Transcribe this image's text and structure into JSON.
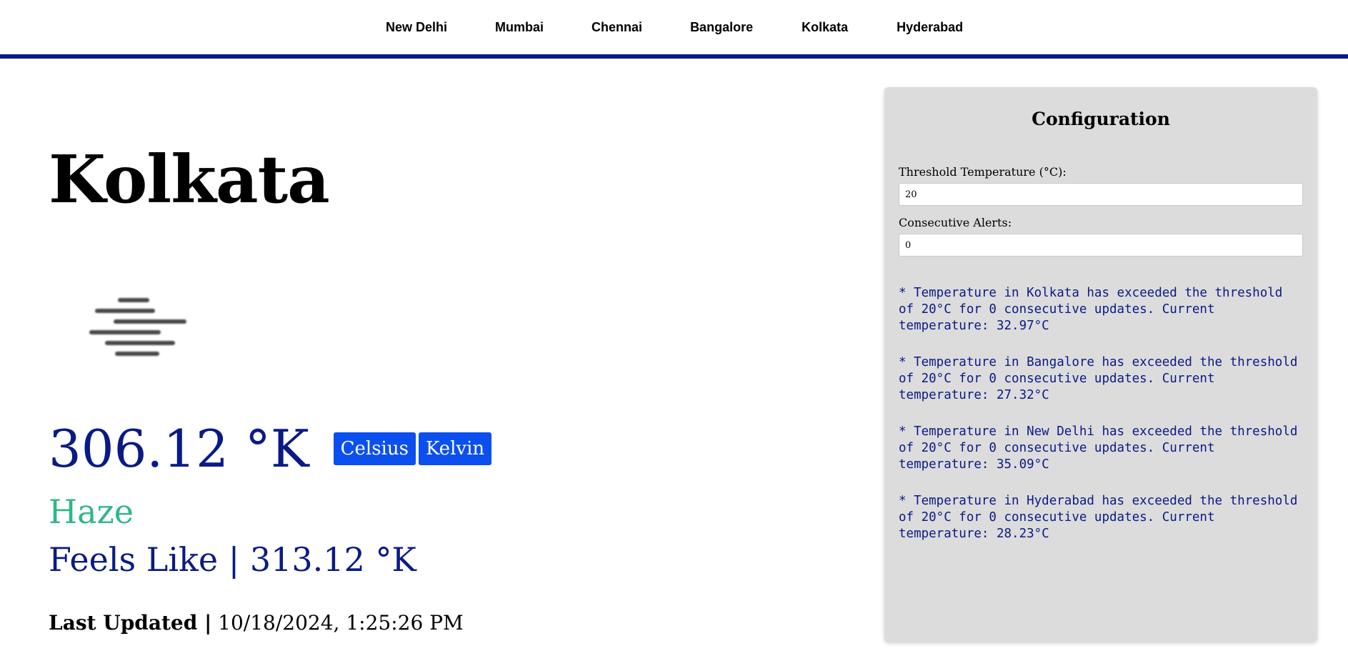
{
  "nav": {
    "items": [
      "New Delhi",
      "Mumbai",
      "Chennai",
      "Bangalore",
      "Kolkata",
      "Hyderabad"
    ]
  },
  "weather": {
    "city": "Kolkata",
    "icon": "haze-icon",
    "temperature": "306.12 °K",
    "celsius_label": "Celsius",
    "kelvin_label": "Kelvin",
    "condition": "Haze",
    "feels_like": "Feels Like | 313.12 °K",
    "last_updated_label": "Last Updated |",
    "last_updated_value": " 10/18/2024, 1:25:26 PM"
  },
  "config": {
    "title": "Configuration",
    "threshold_label": "Threshold Temperature (°C):",
    "threshold_value": "20",
    "consecutive_label": "Consecutive Alerts:",
    "consecutive_value": "0",
    "alerts": [
      "* Temperature in Kolkata has exceeded the threshold of 20°C for 0 consecutive updates. Current temperature: 32.97°C",
      "* Temperature in Bangalore has exceeded the threshold of 20°C for 0 consecutive updates. Current temperature: 27.32°C",
      "* Temperature in New Delhi has exceeded the threshold of 20°C for 0 consecutive updates. Current temperature: 35.09°C",
      "* Temperature in Hyderabad has exceeded the threshold of 20°C for 0 consecutive updates. Current temperature: 28.23°C"
    ]
  },
  "colors": {
    "accent_navy": "#0a1a85",
    "button_blue": "#0b4fef",
    "condition_green": "#2db885",
    "panel_gray": "#dcdcdc"
  }
}
